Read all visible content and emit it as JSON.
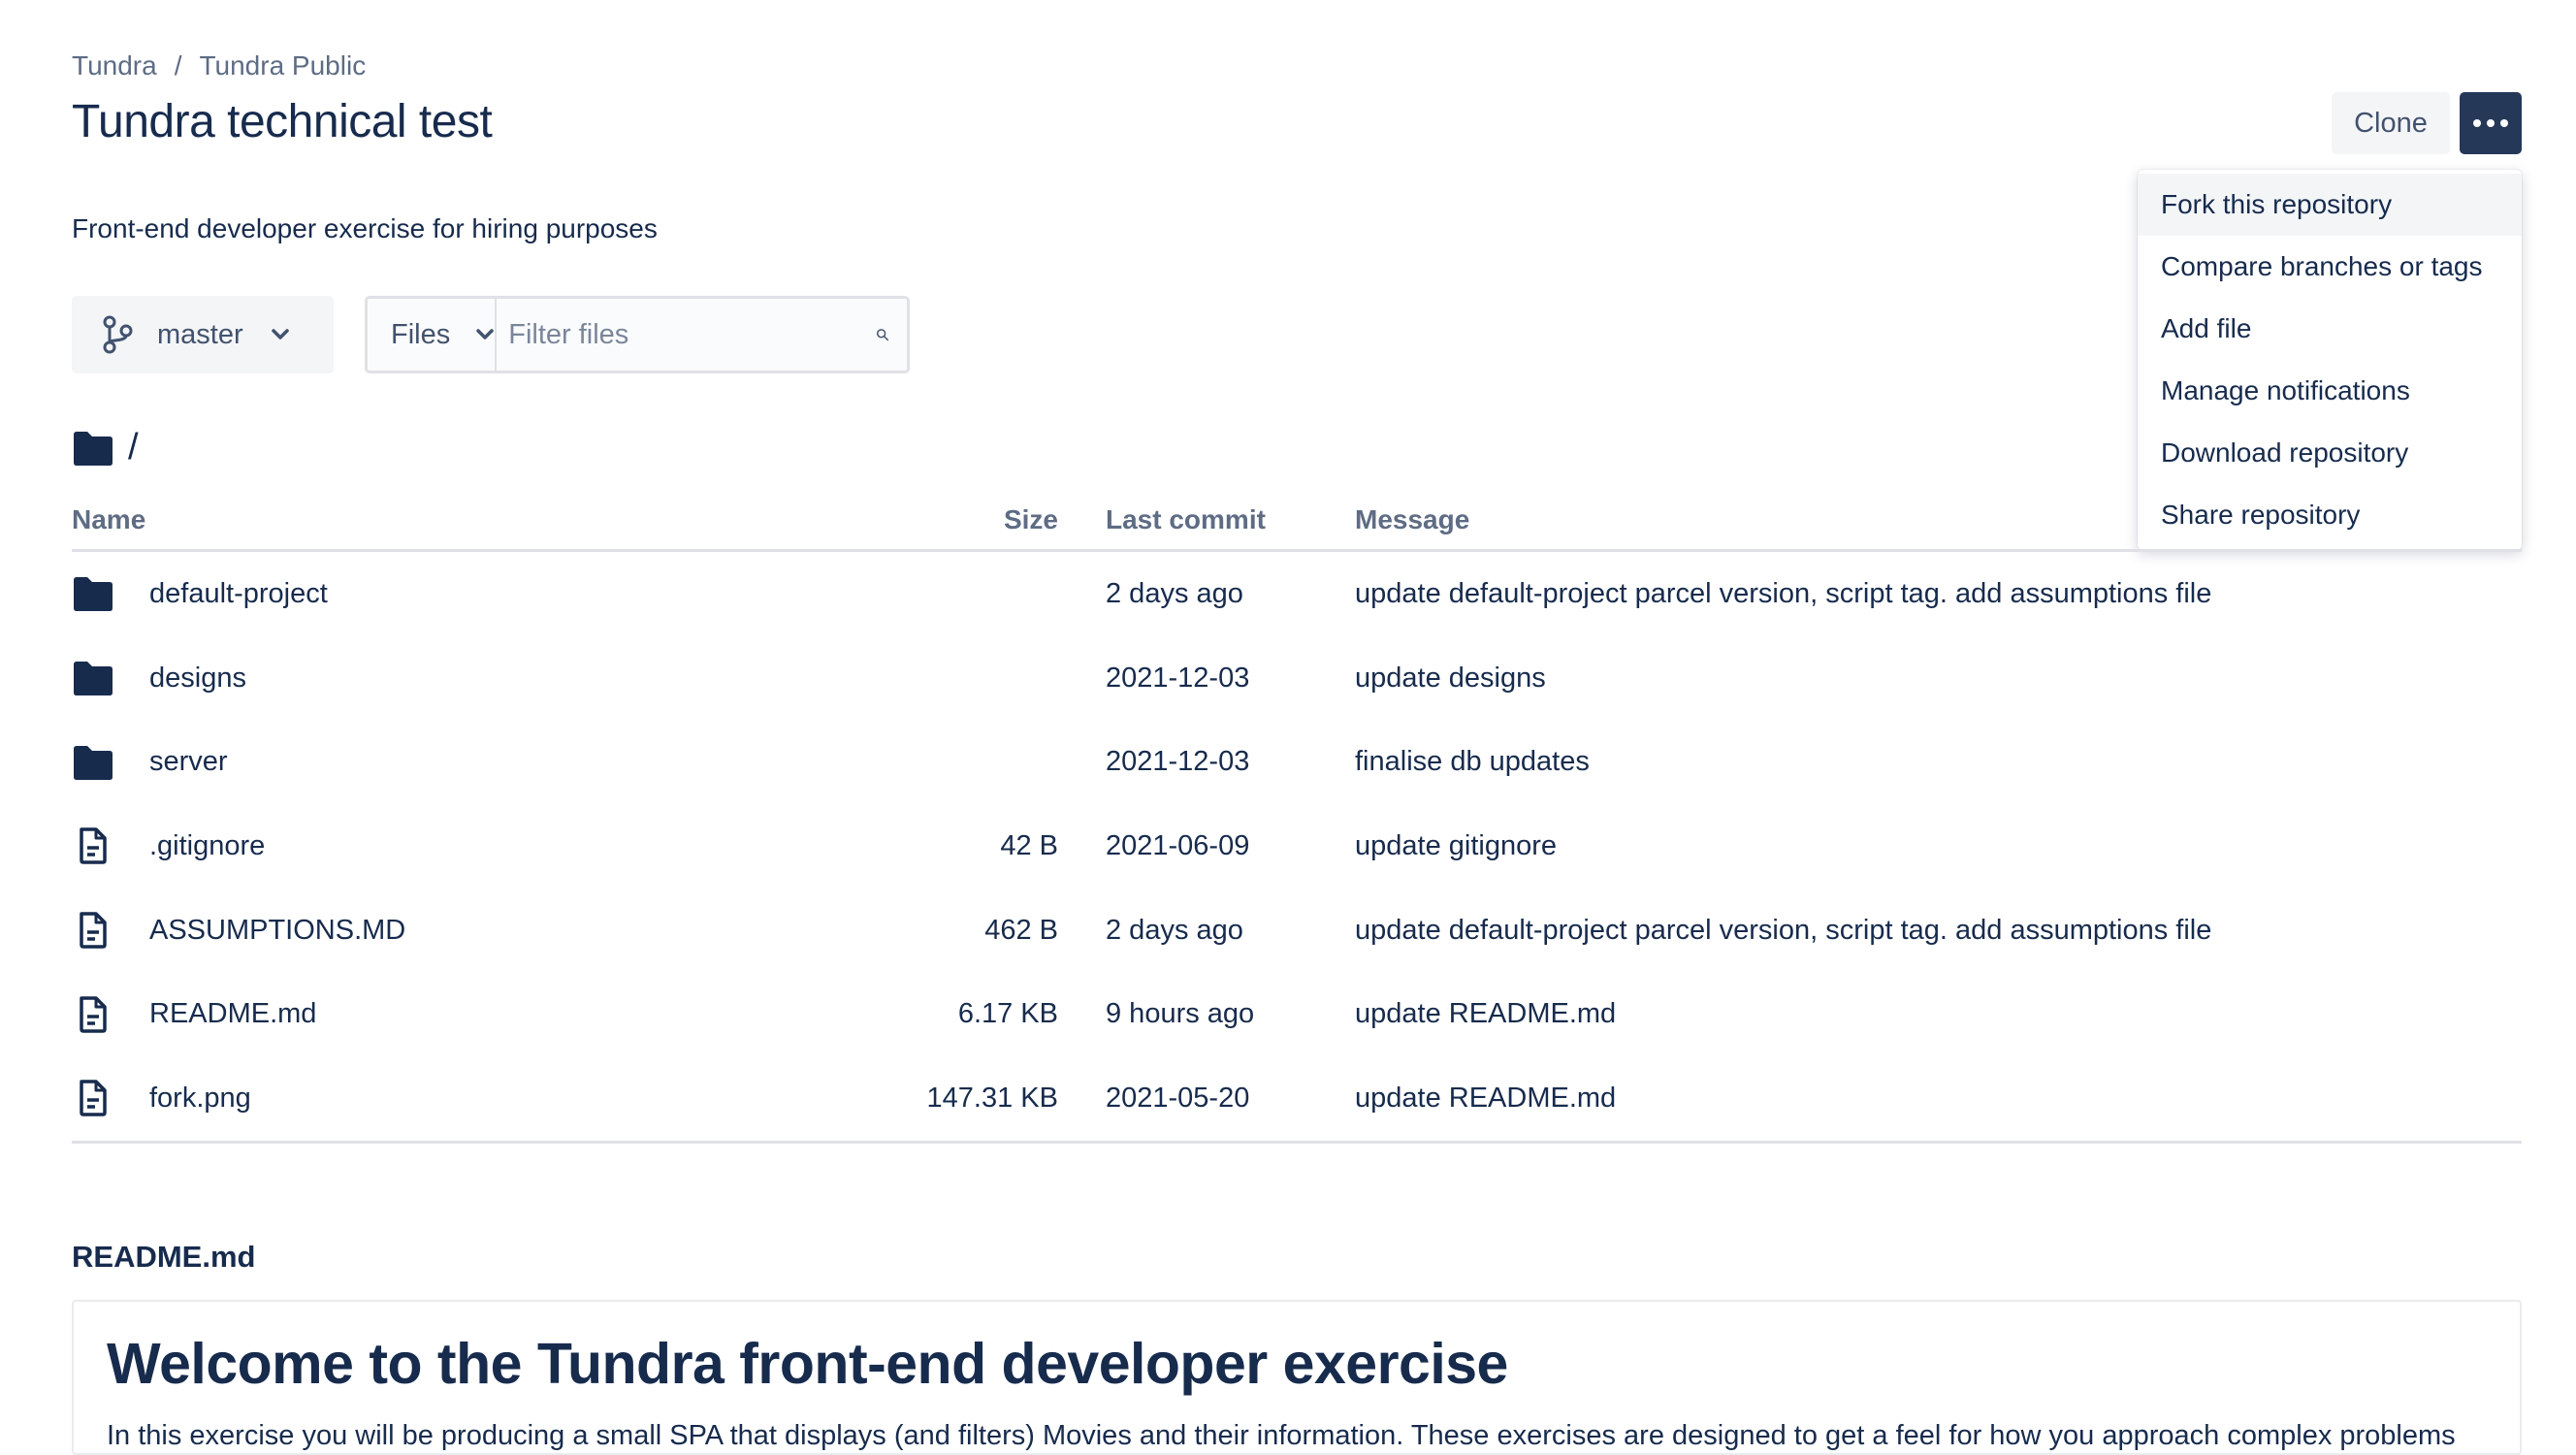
{
  "breadcrumb": [
    "Tundra",
    "Tundra Public"
  ],
  "breadcrumb_separator": "/",
  "repo": {
    "title": "Tundra technical test",
    "description": "Front-end developer exercise for hiring purposes"
  },
  "actions": {
    "clone_label": "Clone",
    "more_icon": "ellipsis-icon"
  },
  "menu": {
    "items": [
      {
        "label": "Fork this repository",
        "active": true
      },
      {
        "label": "Compare branches or tags"
      },
      {
        "label": "Add file"
      },
      {
        "label": "Manage notifications"
      },
      {
        "label": "Download repository"
      },
      {
        "label": "Share repository"
      }
    ]
  },
  "branch": {
    "label": "master",
    "icon": "branch-icon"
  },
  "filter": {
    "mode_label": "Files",
    "placeholder": "Filter files"
  },
  "path": {
    "icon": "folder-icon",
    "label": "/"
  },
  "table": {
    "headers": {
      "name": "Name",
      "size": "Size",
      "commit": "Last commit",
      "message": "Message"
    },
    "rows": [
      {
        "type": "folder",
        "name": "default-project",
        "size": "",
        "commit": "2 days ago",
        "message": "update default-project parcel version, script tag. add assumptions file"
      },
      {
        "type": "folder",
        "name": "designs",
        "size": "",
        "commit": "2021-12-03",
        "message": "update designs"
      },
      {
        "type": "folder",
        "name": "server",
        "size": "",
        "commit": "2021-12-03",
        "message": "finalise db updates"
      },
      {
        "type": "file",
        "name": ".gitignore",
        "size": "42 B",
        "commit": "2021-06-09",
        "message": "update gitignore"
      },
      {
        "type": "file",
        "name": "ASSUMPTIONS.MD",
        "size": "462 B",
        "commit": "2 days ago",
        "message": "update default-project parcel version, script tag. add assumptions file"
      },
      {
        "type": "file",
        "name": "README.md",
        "size": "6.17 KB",
        "commit": "9 hours ago",
        "message": "update README.md"
      },
      {
        "type": "file",
        "name": "fork.png",
        "size": "147.31 KB",
        "commit": "2021-05-20",
        "message": "update README.md"
      }
    ]
  },
  "readme": {
    "label": "README.md",
    "heading": "Welcome to the Tundra front-end developer exercise",
    "text": "In this exercise you will be producing a small SPA that displays (and filters) Movies and their information. These exercises are designed to get a feel for how you approach complex problems"
  },
  "colors": {
    "primary_dark": "#253858",
    "text": "#172b4d",
    "muted": "#5e6c84",
    "border": "#dfe1e6"
  }
}
